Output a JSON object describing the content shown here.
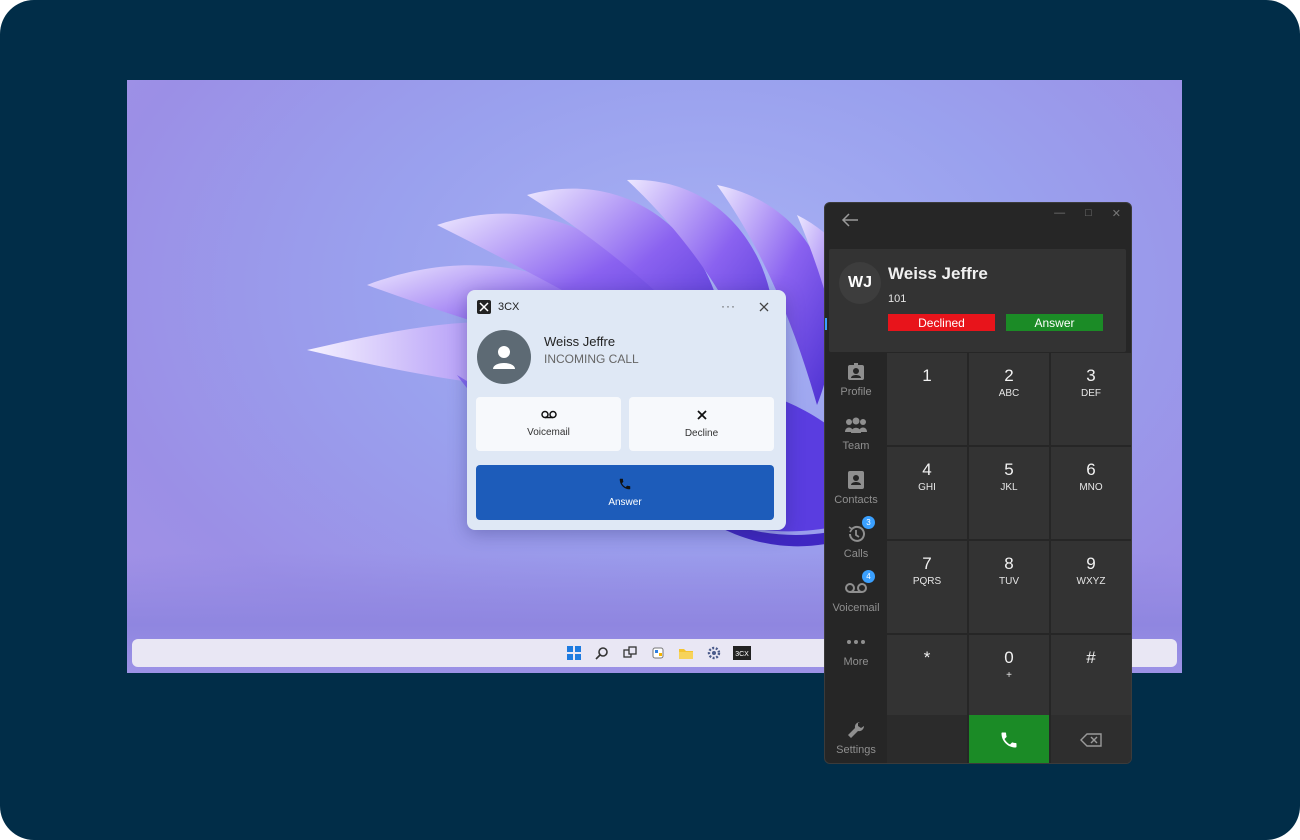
{
  "toast": {
    "app_name": "3CX",
    "more_label": "···",
    "caller_name": "Weiss Jeffre",
    "status": "INCOMING CALL",
    "voicemail_label": "Voicemail",
    "decline_label": "Decline",
    "answer_label": "Answer"
  },
  "window": {
    "caller_initials": "WJ",
    "caller_name": "Weiss Jeffre",
    "extension": "101",
    "declined_label": "Declined",
    "answer_label": "Answer"
  },
  "nav": {
    "items": [
      {
        "label": "Profile",
        "icon": "profile-icon"
      },
      {
        "label": "Team",
        "icon": "team-icon"
      },
      {
        "label": "Contacts",
        "icon": "contacts-icon"
      },
      {
        "label": "Calls",
        "icon": "calls-icon",
        "badge": "3"
      },
      {
        "label": "Voicemail",
        "icon": "voicemail-icon",
        "badge": "4"
      },
      {
        "label": "More",
        "icon": "more-icon"
      },
      {
        "label": "Settings",
        "icon": "settings-icon"
      }
    ]
  },
  "keypad": {
    "keys": [
      {
        "digit": "1",
        "letters": ""
      },
      {
        "digit": "2",
        "letters": "ABC"
      },
      {
        "digit": "3",
        "letters": "DEF"
      },
      {
        "digit": "4",
        "letters": "GHI"
      },
      {
        "digit": "5",
        "letters": "JKL"
      },
      {
        "digit": "6",
        "letters": "MNO"
      },
      {
        "digit": "7",
        "letters": "PQRS"
      },
      {
        "digit": "8",
        "letters": "TUV"
      },
      {
        "digit": "9",
        "letters": "WXYZ"
      },
      {
        "digit": "*",
        "letters": ""
      },
      {
        "digit": "0",
        "letters": "+"
      },
      {
        "digit": "#",
        "letters": ""
      }
    ]
  },
  "taskbar": {
    "icons": [
      "windows-start-icon",
      "search-icon",
      "task-view-icon",
      "widgets-icon",
      "file-explorer-icon",
      "settings-icon",
      "3cx-app-icon"
    ]
  },
  "colors": {
    "frame_bg": "#012d48",
    "declined": "#e8141b",
    "answer_green": "#1b8b26",
    "answer_blue": "#1d5cba",
    "badge_blue": "#3aa0ff"
  }
}
